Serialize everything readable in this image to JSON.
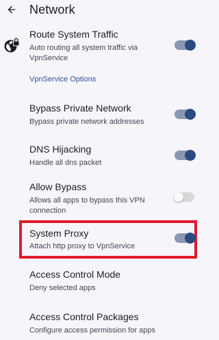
{
  "header": {
    "title": "Network",
    "back_icon": "arrow-back-icon"
  },
  "route_system_traffic": {
    "title": "Route System Traffic",
    "subtitle": "Auto routing all system traffic via VpnService",
    "icon": "vpn-globe-lock-icon",
    "enabled": true
  },
  "section": {
    "label": "VpnService Options"
  },
  "bypass_private_network": {
    "title": "Bypass Private Network",
    "subtitle": "Bypass private network addresses",
    "enabled": true
  },
  "dns_hijacking": {
    "title": "DNS Hijacking",
    "subtitle": "Handle all dns packet",
    "enabled": true
  },
  "allow_bypass": {
    "title": "Allow Bypass",
    "subtitle": "Allows all apps to bypass this VPN connection",
    "enabled": false
  },
  "system_proxy": {
    "title": "System Proxy",
    "subtitle": "Attach http proxy to VpnService",
    "enabled": true,
    "highlight_color": "#e3182a"
  },
  "access_control_mode": {
    "title": "Access Control Mode",
    "subtitle": "Deny selected apps"
  },
  "access_control_packages": {
    "title": "Access Control Packages",
    "subtitle": "Configure access permission for apps"
  },
  "colors": {
    "switch_track_on": "#8a97b3",
    "switch_thumb_on": "#2b4a7f",
    "section_header": "#34519a",
    "background": "#f5f5fa"
  }
}
